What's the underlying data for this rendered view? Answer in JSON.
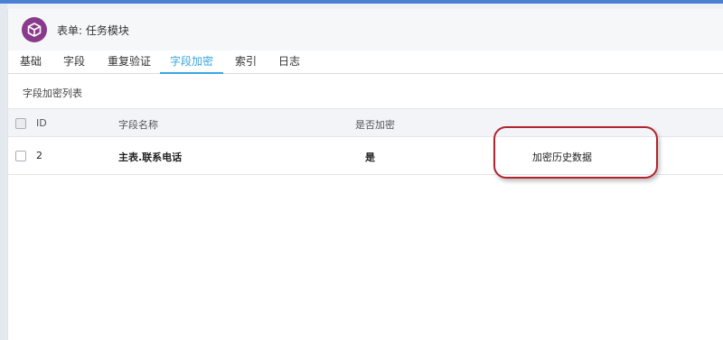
{
  "header": {
    "icon": "cube-icon",
    "title": "表单: 任务模块",
    "icon_color": "#8a3a8c"
  },
  "tabs": [
    {
      "label": "基础"
    },
    {
      "label": "字段"
    },
    {
      "label": "重复验证"
    },
    {
      "label": "字段加密",
      "active": true
    },
    {
      "label": "索引"
    },
    {
      "label": "日志"
    }
  ],
  "section": {
    "title": "字段加密列表"
  },
  "table": {
    "columns": {
      "id": "ID",
      "field_name": "字段名称",
      "encrypted": "是否加密"
    },
    "rows": [
      {
        "id": "2",
        "field_name": "主表.联系电话",
        "encrypted": "是",
        "action": "加密历史数据"
      }
    ]
  },
  "colors": {
    "accent": "#3aa6e0",
    "link": "#3f7bd1",
    "annotation": "#b3242e"
  }
}
